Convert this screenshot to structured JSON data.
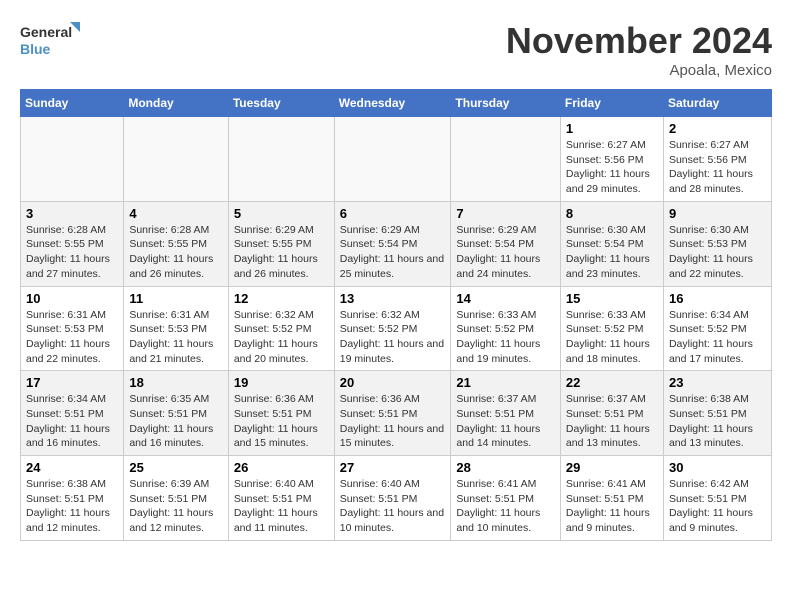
{
  "logo": {
    "line1": "General",
    "line2": "Blue"
  },
  "title": "November 2024",
  "subtitle": "Apoala, Mexico",
  "days_of_week": [
    "Sunday",
    "Monday",
    "Tuesday",
    "Wednesday",
    "Thursday",
    "Friday",
    "Saturday"
  ],
  "weeks": [
    [
      {
        "day": "",
        "info": ""
      },
      {
        "day": "",
        "info": ""
      },
      {
        "day": "",
        "info": ""
      },
      {
        "day": "",
        "info": ""
      },
      {
        "day": "",
        "info": ""
      },
      {
        "day": "1",
        "info": "Sunrise: 6:27 AM\nSunset: 5:56 PM\nDaylight: 11 hours and 29 minutes."
      },
      {
        "day": "2",
        "info": "Sunrise: 6:27 AM\nSunset: 5:56 PM\nDaylight: 11 hours and 28 minutes."
      }
    ],
    [
      {
        "day": "3",
        "info": "Sunrise: 6:28 AM\nSunset: 5:55 PM\nDaylight: 11 hours and 27 minutes."
      },
      {
        "day": "4",
        "info": "Sunrise: 6:28 AM\nSunset: 5:55 PM\nDaylight: 11 hours and 26 minutes."
      },
      {
        "day": "5",
        "info": "Sunrise: 6:29 AM\nSunset: 5:55 PM\nDaylight: 11 hours and 26 minutes."
      },
      {
        "day": "6",
        "info": "Sunrise: 6:29 AM\nSunset: 5:54 PM\nDaylight: 11 hours and 25 minutes."
      },
      {
        "day": "7",
        "info": "Sunrise: 6:29 AM\nSunset: 5:54 PM\nDaylight: 11 hours and 24 minutes."
      },
      {
        "day": "8",
        "info": "Sunrise: 6:30 AM\nSunset: 5:54 PM\nDaylight: 11 hours and 23 minutes."
      },
      {
        "day": "9",
        "info": "Sunrise: 6:30 AM\nSunset: 5:53 PM\nDaylight: 11 hours and 22 minutes."
      }
    ],
    [
      {
        "day": "10",
        "info": "Sunrise: 6:31 AM\nSunset: 5:53 PM\nDaylight: 11 hours and 22 minutes."
      },
      {
        "day": "11",
        "info": "Sunrise: 6:31 AM\nSunset: 5:53 PM\nDaylight: 11 hours and 21 minutes."
      },
      {
        "day": "12",
        "info": "Sunrise: 6:32 AM\nSunset: 5:52 PM\nDaylight: 11 hours and 20 minutes."
      },
      {
        "day": "13",
        "info": "Sunrise: 6:32 AM\nSunset: 5:52 PM\nDaylight: 11 hours and 19 minutes."
      },
      {
        "day": "14",
        "info": "Sunrise: 6:33 AM\nSunset: 5:52 PM\nDaylight: 11 hours and 19 minutes."
      },
      {
        "day": "15",
        "info": "Sunrise: 6:33 AM\nSunset: 5:52 PM\nDaylight: 11 hours and 18 minutes."
      },
      {
        "day": "16",
        "info": "Sunrise: 6:34 AM\nSunset: 5:52 PM\nDaylight: 11 hours and 17 minutes."
      }
    ],
    [
      {
        "day": "17",
        "info": "Sunrise: 6:34 AM\nSunset: 5:51 PM\nDaylight: 11 hours and 16 minutes."
      },
      {
        "day": "18",
        "info": "Sunrise: 6:35 AM\nSunset: 5:51 PM\nDaylight: 11 hours and 16 minutes."
      },
      {
        "day": "19",
        "info": "Sunrise: 6:36 AM\nSunset: 5:51 PM\nDaylight: 11 hours and 15 minutes."
      },
      {
        "day": "20",
        "info": "Sunrise: 6:36 AM\nSunset: 5:51 PM\nDaylight: 11 hours and 15 minutes."
      },
      {
        "day": "21",
        "info": "Sunrise: 6:37 AM\nSunset: 5:51 PM\nDaylight: 11 hours and 14 minutes."
      },
      {
        "day": "22",
        "info": "Sunrise: 6:37 AM\nSunset: 5:51 PM\nDaylight: 11 hours and 13 minutes."
      },
      {
        "day": "23",
        "info": "Sunrise: 6:38 AM\nSunset: 5:51 PM\nDaylight: 11 hours and 13 minutes."
      }
    ],
    [
      {
        "day": "24",
        "info": "Sunrise: 6:38 AM\nSunset: 5:51 PM\nDaylight: 11 hours and 12 minutes."
      },
      {
        "day": "25",
        "info": "Sunrise: 6:39 AM\nSunset: 5:51 PM\nDaylight: 11 hours and 12 minutes."
      },
      {
        "day": "26",
        "info": "Sunrise: 6:40 AM\nSunset: 5:51 PM\nDaylight: 11 hours and 11 minutes."
      },
      {
        "day": "27",
        "info": "Sunrise: 6:40 AM\nSunset: 5:51 PM\nDaylight: 11 hours and 10 minutes."
      },
      {
        "day": "28",
        "info": "Sunrise: 6:41 AM\nSunset: 5:51 PM\nDaylight: 11 hours and 10 minutes."
      },
      {
        "day": "29",
        "info": "Sunrise: 6:41 AM\nSunset: 5:51 PM\nDaylight: 11 hours and 9 minutes."
      },
      {
        "day": "30",
        "info": "Sunrise: 6:42 AM\nSunset: 5:51 PM\nDaylight: 11 hours and 9 minutes."
      }
    ]
  ]
}
